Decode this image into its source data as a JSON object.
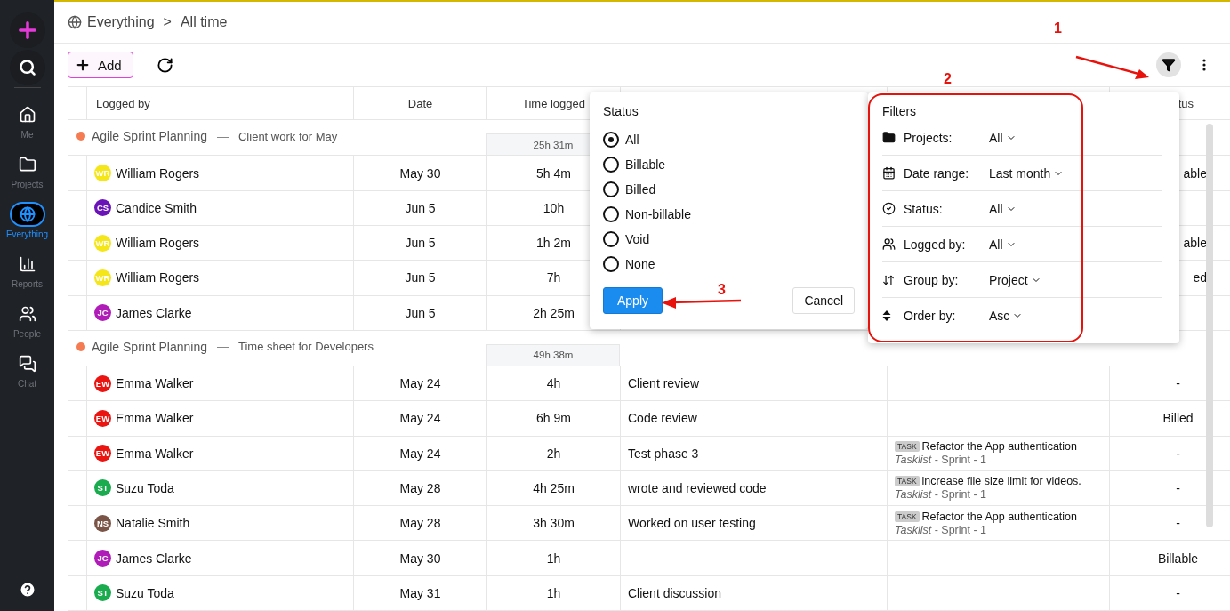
{
  "sidebar": {
    "items": [
      {
        "kind": "add"
      },
      {
        "kind": "search"
      },
      {
        "kind": "home",
        "label": "Me",
        "selected": false
      },
      {
        "kind": "projects",
        "label": "Projects",
        "selected": false
      },
      {
        "kind": "everything",
        "label": "Everything",
        "selected": true
      },
      {
        "kind": "reports",
        "label": "Reports",
        "selected": false
      },
      {
        "kind": "people",
        "label": "People",
        "selected": false
      },
      {
        "kind": "chat",
        "label": "Chat",
        "selected": false
      },
      {
        "kind": "help"
      }
    ]
  },
  "breadcrumb": {
    "root": "Everything",
    "separator": ">",
    "current": "All time"
  },
  "toolbar": {
    "add_label": "Add"
  },
  "table": {
    "header": {
      "logged_by": "Logged by",
      "date": "Date",
      "time_logged": "Time logged",
      "status": "tus"
    },
    "groups": [
      {
        "project": "Agile Sprint Planning",
        "color": "#f47b52",
        "dash": "—",
        "sheet": "Client work for May",
        "total": "25h 31m",
        "rows": [
          {
            "initials": "WR",
            "color": "#f5e61a",
            "name": "William Rogers",
            "date": "May 30",
            "time": "5h 4m",
            "status": "able",
            "status_cut": true
          },
          {
            "initials": "CS",
            "color": "#6a13b8",
            "name": "Candice Smith",
            "date": "Jun 5",
            "time": "10h"
          },
          {
            "initials": "WR",
            "color": "#f5e61a",
            "name": "William Rogers",
            "date": "Jun 5",
            "time": "1h 2m",
            "status": "able",
            "status_cut": true
          },
          {
            "initials": "WR",
            "color": "#f5e61a",
            "name": "William Rogers",
            "date": "Jun 5",
            "time": "7h",
            "status": "ed",
            "status_cut": true
          },
          {
            "initials": "JC",
            "color": "#b01cb8",
            "name": "James Clarke",
            "date": "Jun 5",
            "time": "2h 25m"
          }
        ]
      },
      {
        "project": "Agile Sprint Planning",
        "color": "#f47b52",
        "dash": "—",
        "sheet": "Time sheet for Developers",
        "total": "49h 38m",
        "rows": [
          {
            "initials": "EW",
            "color": "#ea1410",
            "name": "Emma Walker",
            "date": "May 24",
            "time": "4h",
            "description": "Client review",
            "status": "-"
          },
          {
            "initials": "EW",
            "color": "#ea1410",
            "name": "Emma Walker",
            "date": "May 24",
            "time": "6h 9m",
            "description": "Code review",
            "status": "Billed"
          },
          {
            "initials": "EW",
            "color": "#ea1410",
            "name": "Emma Walker",
            "date": "May 24",
            "time": "2h",
            "description": "Test phase 3",
            "task": {
              "tag": "TASK",
              "title": "Refactor the App authentication",
              "list": "Tasklist",
              "path": " - Sprint - 1"
            },
            "status": "-"
          },
          {
            "initials": "ST",
            "color": "#1aab4e",
            "name": "Suzu Toda",
            "date": "May 28",
            "time": "4h 25m",
            "description": "wrote and reviewed code",
            "task": {
              "tag": "TASK",
              "title": "increase file size limit for videos.",
              "list": "Tasklist",
              "path": " - Sprint - 1"
            },
            "status": "-"
          },
          {
            "initials": "NS",
            "color": "#7a5446",
            "name": "Natalie Smith",
            "date": "May 28",
            "time": "3h 30m",
            "description": "Worked on user testing",
            "task": {
              "tag": "TASK",
              "title": "Refactor the App authentication",
              "list": "Tasklist",
              "path": " - Sprint - 1"
            },
            "status": "-"
          },
          {
            "initials": "JC",
            "color": "#b01cb8",
            "name": "James Clarke",
            "date": "May 30",
            "time": "1h",
            "status": "Billable"
          },
          {
            "initials": "ST",
            "color": "#1aab4e",
            "name": "Suzu Toda",
            "date": "May 31",
            "time": "1h",
            "description": "Client discussion",
            "status": "-"
          }
        ]
      }
    ]
  },
  "status_popover": {
    "title": "Status",
    "options": [
      {
        "label": "All",
        "selected": true
      },
      {
        "label": "Billable",
        "selected": false
      },
      {
        "label": "Billed",
        "selected": false
      },
      {
        "label": "Non-billable",
        "selected": false
      },
      {
        "label": "Void",
        "selected": false
      },
      {
        "label": "None",
        "selected": false
      }
    ],
    "apply": "Apply",
    "cancel": "Cancel"
  },
  "filters_popover": {
    "title": "Filters",
    "rows": [
      {
        "kind": "projects",
        "label": "Projects:",
        "value": "All"
      },
      {
        "kind": "date_range",
        "label": "Date range:",
        "value": "Last month"
      },
      {
        "kind": "status",
        "label": "Status:",
        "value": "All"
      },
      {
        "kind": "logged_by",
        "label": "Logged by:",
        "value": "All"
      },
      {
        "kind": "group_by",
        "label": "Group by:",
        "value": "Project"
      },
      {
        "kind": "order_by",
        "label": "Order by:",
        "value": "Asc"
      }
    ]
  },
  "annotations": [
    {
      "label": "1"
    },
    {
      "label": "2"
    },
    {
      "label": "3"
    }
  ]
}
